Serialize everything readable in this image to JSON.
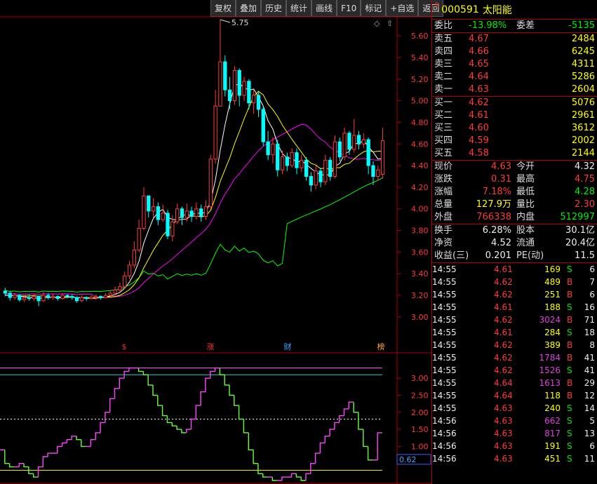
{
  "toolbar": [
    "复权",
    "叠加",
    "历史",
    "统计",
    "画线",
    "F10",
    "标记",
    "+自选",
    "返回"
  ],
  "stock": {
    "badge": "R",
    "code": "000591",
    "name": "太阳能"
  },
  "weibi": {
    "l1": "委比",
    "v1": "-13.98%",
    "l2": "委差",
    "v2": "-5135"
  },
  "asks": [
    {
      "label": "卖五",
      "price": "4.67",
      "vol": "2484"
    },
    {
      "label": "卖四",
      "price": "4.66",
      "vol": "6245"
    },
    {
      "label": "卖三",
      "price": "4.65",
      "vol": "4311"
    },
    {
      "label": "卖二",
      "price": "4.64",
      "vol": "5286"
    },
    {
      "label": "卖一",
      "price": "4.63",
      "vol": "2604"
    }
  ],
  "bids": [
    {
      "label": "买一",
      "price": "4.62",
      "vol": "5076"
    },
    {
      "label": "买二",
      "price": "4.61",
      "vol": "2961"
    },
    {
      "label": "买三",
      "price": "4.60",
      "vol": "3612"
    },
    {
      "label": "买四",
      "price": "4.59",
      "vol": "2002"
    },
    {
      "label": "买五",
      "price": "4.58",
      "vol": "2144"
    }
  ],
  "quote": [
    {
      "l1": "现价",
      "v1": "4.63",
      "c1": "red",
      "l2": "今开",
      "v2": "4.32",
      "c2": "wht"
    },
    {
      "l1": "涨跌",
      "v1": "0.31",
      "c1": "red",
      "l2": "最高",
      "v2": "4.75",
      "c2": "red"
    },
    {
      "l1": "涨幅",
      "v1": "7.18%",
      "c1": "red",
      "l2": "最低",
      "v2": "4.28",
      "c2": "grn"
    },
    {
      "l1": "总量",
      "v1": "127.9万",
      "c1": "yel",
      "l2": "量比",
      "v2": "2.30",
      "c2": "red"
    },
    {
      "l1": "外盘",
      "v1": "766338",
      "c1": "red",
      "l2": "内盘",
      "v2": "512997",
      "c2": "grn"
    }
  ],
  "fund": [
    {
      "l1": "换手",
      "v1": "6.28%",
      "l2": "股本",
      "v2": "30.1亿"
    },
    {
      "l1": "净资",
      "v1": "4.52",
      "l2": "流通",
      "v2": "20.4亿"
    },
    {
      "l1": "收益(三)",
      "v1": "0.201",
      "l2": "PE(动)",
      "v2": "11.5"
    }
  ],
  "ticks": [
    {
      "t": "14:55",
      "p": "4.61",
      "v": "169",
      "s": "S",
      "n": "6"
    },
    {
      "t": "14:55",
      "p": "4.62",
      "v": "489",
      "s": "B",
      "n": "7"
    },
    {
      "t": "14:55",
      "p": "4.62",
      "v": "251",
      "s": "B",
      "n": "6"
    },
    {
      "t": "14:55",
      "p": "4.61",
      "v": "188",
      "s": "S",
      "n": "16"
    },
    {
      "t": "14:55",
      "p": "4.62",
      "v": "3024",
      "s": "B",
      "n": "71"
    },
    {
      "t": "14:55",
      "p": "4.61",
      "v": "284",
      "s": "S",
      "n": "18"
    },
    {
      "t": "14:55",
      "p": "4.62",
      "v": "389",
      "s": "B",
      "n": "8"
    },
    {
      "t": "14:55",
      "p": "4.62",
      "v": "1784",
      "s": "B",
      "n": "41"
    },
    {
      "t": "14:55",
      "p": "4.62",
      "v": "1526",
      "s": "S",
      "n": "41"
    },
    {
      "t": "14:55",
      "p": "4.64",
      "v": "1613",
      "s": "B",
      "n": "29"
    },
    {
      "t": "14:55",
      "p": "4.64",
      "v": "118",
      "s": "B",
      "n": "12"
    },
    {
      "t": "14:55",
      "p": "4.63",
      "v": "240",
      "s": "S",
      "n": "14"
    },
    {
      "t": "14:56",
      "p": "4.63",
      "v": "662",
      "s": "S",
      "n": "5"
    },
    {
      "t": "14:56",
      "p": "4.63",
      "v": "817",
      "s": "S",
      "n": "13"
    },
    {
      "t": "14:56",
      "p": "4.63",
      "v": "191",
      "s": "S",
      "n": "6"
    },
    {
      "t": "14:56",
      "p": "4.63",
      "v": "451",
      "s": "S",
      "n": "11"
    }
  ],
  "colors": {
    "up": "#ff3b3b",
    "down": "#00ffff",
    "ma5": "#ffffff",
    "ma10": "#ffff00",
    "ma20": "#ff00ff",
    "ma60": "#00ff00",
    "border": "#aa0000"
  },
  "chart_data": [
    {
      "type": "candlestick",
      "peak_annotation": "5.75",
      "ylim": [
        2.85,
        5.75
      ],
      "yticks": [
        "5.60",
        "5.40",
        "5.20",
        "5.00",
        "4.80",
        "4.60",
        "4.40",
        "4.20",
        "4.00",
        "3.80",
        "3.60",
        "3.40",
        "3.20",
        "3.00"
      ],
      "markers": [
        {
          "label": "$",
          "color": "#ff3333"
        },
        {
          "label": "涨",
          "color": "#ff3333"
        },
        {
          "label": "财",
          "color": "#33aaff"
        },
        {
          "label": "榜",
          "color": "#ffaa33"
        }
      ],
      "candles": [
        [
          3.24,
          3.22,
          3.27,
          3.19
        ],
        [
          3.22,
          3.18,
          3.24,
          3.15
        ],
        [
          3.18,
          3.2,
          3.22,
          3.16
        ],
        [
          3.2,
          3.16,
          3.21,
          3.14
        ],
        [
          3.16,
          3.18,
          3.2,
          3.14
        ],
        [
          3.18,
          3.17,
          3.21,
          3.15
        ],
        [
          3.17,
          3.19,
          3.21,
          3.15
        ],
        [
          3.19,
          3.15,
          3.2,
          3.1
        ],
        [
          3.15,
          3.2,
          3.23,
          3.14
        ],
        [
          3.2,
          3.18,
          3.22,
          3.16
        ],
        [
          3.18,
          3.19,
          3.21,
          3.16
        ],
        [
          3.19,
          3.17,
          3.2,
          3.15
        ],
        [
          3.17,
          3.2,
          3.22,
          3.16
        ],
        [
          3.2,
          3.19,
          3.21,
          3.17
        ],
        [
          3.19,
          3.18,
          3.21,
          3.16
        ],
        [
          3.18,
          3.15,
          3.19,
          3.13
        ],
        [
          3.15,
          3.18,
          3.2,
          3.14
        ],
        [
          3.18,
          3.17,
          3.19,
          3.15
        ],
        [
          3.17,
          3.18,
          3.2,
          3.16
        ],
        [
          3.18,
          3.19,
          3.21,
          3.16
        ],
        [
          3.19,
          3.18,
          3.2,
          3.16
        ],
        [
          3.18,
          3.2,
          3.22,
          3.17
        ],
        [
          3.2,
          3.22,
          3.25,
          3.19
        ],
        [
          3.22,
          3.25,
          3.28,
          3.2
        ],
        [
          3.25,
          3.28,
          3.32,
          3.23
        ],
        [
          3.28,
          3.38,
          3.42,
          3.26
        ],
        [
          3.38,
          3.48,
          3.52,
          3.35
        ],
        [
          3.48,
          3.62,
          3.7,
          3.45
        ],
        [
          3.62,
          3.82,
          3.9,
          3.6
        ],
        [
          3.82,
          4.12,
          4.2,
          3.8
        ],
        [
          4.12,
          3.98,
          4.12,
          3.92
        ],
        [
          3.98,
          4.02,
          4.1,
          3.92
        ],
        [
          4.02,
          3.9,
          4.06,
          3.85
        ],
        [
          3.9,
          3.96,
          4.04,
          3.88
        ],
        [
          3.96,
          3.75,
          3.99,
          3.72
        ],
        [
          3.75,
          3.88,
          3.94,
          3.7
        ],
        [
          3.88,
          4.0,
          4.05,
          3.86
        ],
        [
          4.0,
          3.92,
          4.02,
          3.85
        ],
        [
          3.92,
          3.98,
          4.05,
          3.88
        ],
        [
          3.98,
          3.93,
          4.02,
          3.88
        ],
        [
          3.93,
          4.0,
          4.06,
          3.9
        ],
        [
          4.0,
          3.93,
          4.04,
          3.88
        ],
        [
          3.93,
          4.02,
          4.08,
          3.9
        ],
        [
          4.02,
          4.46,
          4.5,
          4.0
        ],
        [
          4.46,
          4.95,
          5.1,
          4.42
        ],
        [
          4.95,
          5.36,
          5.75,
          4.95
        ],
        [
          5.36,
          5.1,
          5.42,
          5.04
        ],
        [
          5.1,
          5.0,
          5.22,
          4.92
        ],
        [
          5.0,
          5.28,
          5.32,
          4.96
        ],
        [
          5.28,
          5.05,
          5.3,
          4.95
        ],
        [
          5.05,
          5.18,
          5.22,
          5.0
        ],
        [
          5.18,
          4.98,
          5.2,
          4.92
        ],
        [
          4.98,
          5.05,
          5.1,
          4.88
        ],
        [
          5.05,
          4.92,
          5.08,
          4.85
        ],
        [
          4.92,
          4.62,
          4.95,
          4.58
        ],
        [
          4.62,
          4.5,
          4.72,
          4.45
        ],
        [
          4.5,
          4.6,
          4.66,
          4.42
        ],
        [
          4.6,
          4.36,
          4.64,
          4.3
        ],
        [
          4.36,
          4.48,
          4.54,
          4.32
        ],
        [
          4.48,
          4.4,
          4.52,
          4.35
        ],
        [
          4.4,
          4.52,
          4.56,
          4.38
        ],
        [
          4.52,
          4.38,
          4.56,
          4.32
        ],
        [
          4.38,
          4.45,
          4.5,
          4.34
        ],
        [
          4.45,
          4.3,
          4.48,
          4.26
        ],
        [
          4.3,
          4.22,
          4.34,
          4.16
        ],
        [
          4.22,
          4.35,
          4.4,
          4.18
        ],
        [
          4.35,
          4.25,
          4.38,
          4.2
        ],
        [
          4.25,
          4.45,
          4.5,
          4.22
        ],
        [
          4.45,
          4.3,
          4.48,
          4.26
        ],
        [
          4.3,
          4.62,
          4.68,
          4.28
        ],
        [
          4.62,
          4.48,
          4.66,
          4.44
        ],
        [
          4.48,
          4.7,
          4.75,
          4.45
        ],
        [
          4.7,
          4.55,
          4.72,
          4.5
        ],
        [
          4.55,
          4.68,
          4.83,
          4.52
        ],
        [
          4.68,
          4.6,
          4.72,
          4.55
        ],
        [
          4.6,
          4.64,
          4.7,
          4.56
        ],
        [
          4.64,
          4.4,
          4.66,
          4.32
        ],
        [
          4.4,
          4.3,
          4.44,
          4.22
        ],
        [
          4.3,
          4.36,
          4.4,
          4.26
        ],
        [
          4.32,
          4.63,
          4.75,
          4.28
        ]
      ]
    },
    {
      "type": "line",
      "ylim": [
        0,
        3.6
      ],
      "yticks": [
        "3.00",
        "2.50",
        "2.00",
        "1.50",
        "1.00"
      ],
      "current_value": "0.62",
      "levels": [
        3.3,
        3.1,
        1.8,
        0.3
      ],
      "values": [
        0.9,
        0.5,
        0.4,
        0.4,
        0.5,
        0.4,
        0.2,
        0.1,
        0.4,
        0.7,
        0.8,
        0.8,
        1.0,
        1.1,
        1.2,
        1.3,
        1.2,
        1.0,
        1.0,
        1.2,
        1.4,
        1.7,
        2.0,
        2.4,
        2.7,
        3.0,
        3.2,
        3.3,
        3.3,
        3.2,
        3.1,
        2.8,
        2.5,
        2.2,
        1.9,
        1.7,
        1.6,
        1.5,
        1.4,
        1.5,
        1.8,
        2.2,
        2.6,
        3.0,
        3.2,
        3.3,
        3.1,
        2.8,
        2.5,
        2.2,
        1.8,
        1.4,
        0.9,
        0.5,
        0.2,
        0.1,
        0.1,
        0.0,
        0.0,
        0.1,
        0.1,
        0.2,
        0.1,
        0.0,
        0.2,
        0.5,
        0.8,
        1.1,
        1.3,
        1.5,
        1.7,
        1.9,
        2.1,
        2.3,
        2.0,
        1.5,
        1.0,
        0.6,
        0.6,
        1.4
      ]
    }
  ]
}
